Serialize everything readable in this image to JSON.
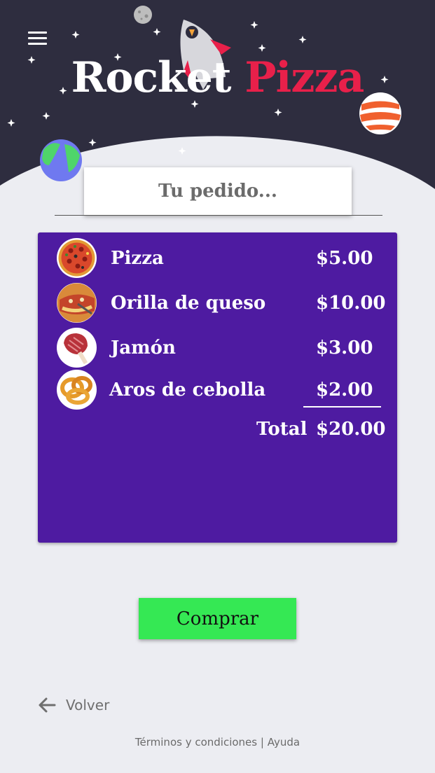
{
  "header": {
    "title_part1": "Rocket",
    "title_part2": "Pizza",
    "menu_icon": "hamburger-menu-icon"
  },
  "order": {
    "heading": "Tu pedido..."
  },
  "items": [
    {
      "name": "Pizza",
      "price": "$5.00",
      "icon": "pizza-icon"
    },
    {
      "name": "Orilla de queso",
      "price": "$10.00",
      "icon": "cheese-crust-icon"
    },
    {
      "name": "Jamón",
      "price": "$3.00",
      "icon": "ham-icon"
    },
    {
      "name": "Aros de cebolla",
      "price": "$2.00",
      "icon": "onion-rings-icon"
    }
  ],
  "total": {
    "label": "Total",
    "value": "$20.00"
  },
  "actions": {
    "buy_label": "Comprar",
    "back_label": "Volver"
  },
  "footer": {
    "terms": "Términos y condiciones",
    "separator": "|",
    "help": "Ayuda"
  },
  "colors": {
    "sky": "#2e2d3f",
    "accent_red": "#e8204a",
    "panel_purple": "#4e1ba1",
    "buy_green": "#35e854",
    "background": "#ecedf2"
  }
}
